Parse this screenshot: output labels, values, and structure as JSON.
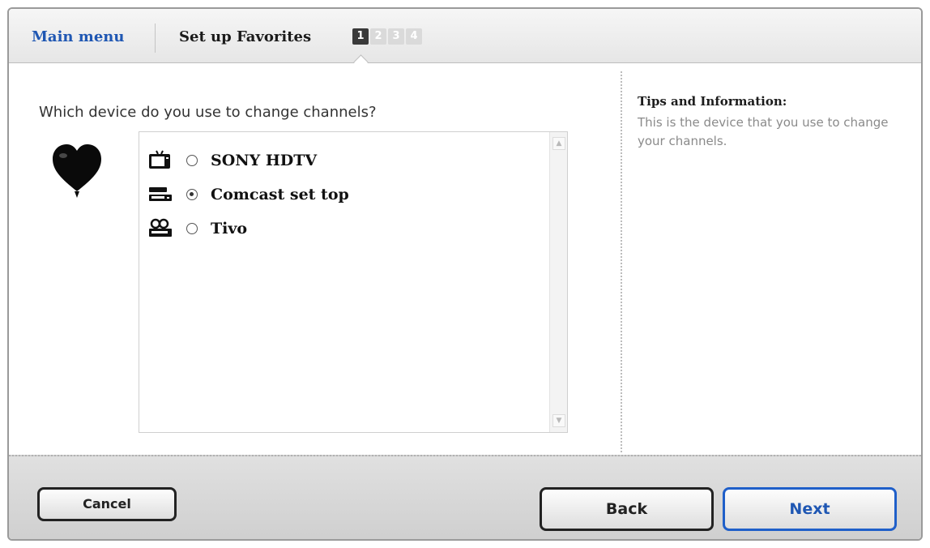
{
  "header": {
    "main_menu": "Main menu",
    "title": "Set up Favorites",
    "steps": [
      "1",
      "2",
      "3",
      "4"
    ],
    "active_step": 1
  },
  "question": "Which device do you use to change channels?",
  "devices": [
    {
      "label": "SONY HDTV",
      "icon": "tv-icon",
      "selected": false
    },
    {
      "label": "Comcast set top",
      "icon": "set-top-box-icon",
      "selected": true
    },
    {
      "label": "Tivo",
      "icon": "tivo-icon",
      "selected": false
    }
  ],
  "tips": {
    "title": "Tips and Information:",
    "body": "This is the device that you use to change your channels."
  },
  "buttons": {
    "cancel": "Cancel",
    "back": "Back",
    "next": "Next"
  },
  "colors": {
    "accent": "#1f57b3",
    "next_border": "#1f5fc9"
  }
}
